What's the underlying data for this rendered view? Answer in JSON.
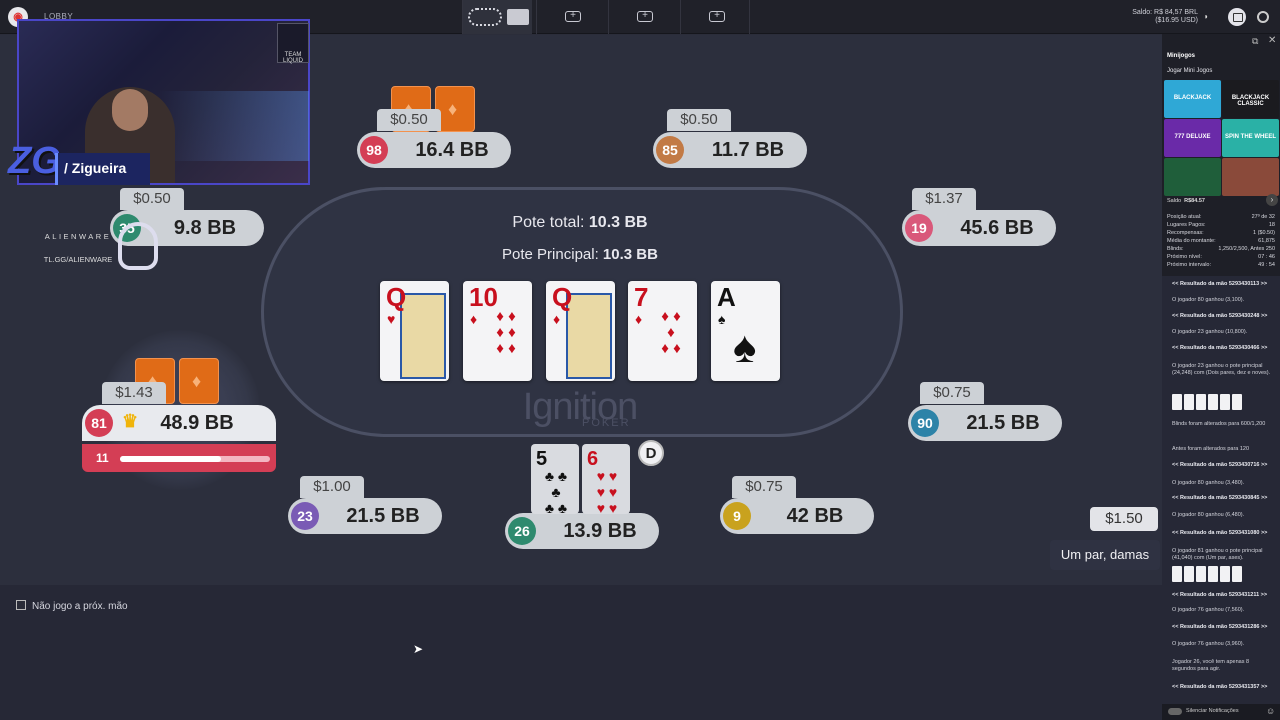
{
  "topbar": {
    "lobby_label": "LOBBY",
    "balance_line1": "Saldo: R$ 84,57 BRL",
    "balance_line2": "($16.95 USD)"
  },
  "table": {
    "pot_total_label": "Pote total:",
    "pot_total_value": "10.3 BB",
    "pot_main_label": "Pote Principal:",
    "pot_main_value": "10.3 BB",
    "watermark": "Ignition",
    "watermark_sub": "POKER",
    "board": [
      {
        "rank": "Q",
        "suit": "♥",
        "color": "red",
        "face": true
      },
      {
        "rank": "10",
        "suit": "♦",
        "color": "red",
        "face": false,
        "pips": "♦ ♦\n♦ ♦\n♦ ♦"
      },
      {
        "rank": "Q",
        "suit": "♦",
        "color": "red",
        "face": true
      },
      {
        "rank": "7",
        "suit": "♦",
        "color": "red",
        "face": false,
        "pips": "♦ ♦\n♦\n♦ ♦"
      },
      {
        "rank": "A",
        "suit": "♠",
        "color": "blk",
        "face": false,
        "ace": true
      }
    ],
    "dealer_label": "D"
  },
  "seats": [
    {
      "id": "98",
      "stack": "16.4 BB",
      "bet": "$0.50",
      "avatar_color": "#d43e55"
    },
    {
      "id": "85",
      "stack": "11.7 BB",
      "bet": "$0.50",
      "avatar_color": "#c27a45"
    },
    {
      "id": "35",
      "stack": "9.8 BB",
      "bet": "$0.50",
      "avatar_color": "#2e8a6e"
    },
    {
      "id": "19",
      "stack": "45.6 BB",
      "bet": "$1.37",
      "avatar_color": "#d9587a"
    },
    {
      "id": "81",
      "stack": "48.9 BB",
      "bet": "$1.43",
      "avatar_color": "#d43e55",
      "timer": "11",
      "timer_fraction": 0.67
    },
    {
      "id": "90",
      "stack": "21.5 BB",
      "bet": "$0.75",
      "avatar_color": "#2d83a8"
    },
    {
      "id": "23",
      "stack": "21.5 BB",
      "bet": "$1.00",
      "avatar_color": "#7a5bb5"
    },
    {
      "id": "26",
      "stack": "13.9 BB",
      "bet": "",
      "avatar_color": "#2e8a6e"
    },
    {
      "id": "9",
      "stack": "42 BB",
      "bet": "$0.75",
      "avatar_color": "#c9a21e"
    }
  ],
  "hero_cards": [
    {
      "rank": "5",
      "suit": "♣",
      "color": "blk",
      "pips": "♣ ♣\n♣\n♣ ♣"
    },
    {
      "rank": "6",
      "suit": "♥",
      "color": "red",
      "pips": "♥ ♥\n♥ ♥\n♥ ♥"
    }
  ],
  "actions": {
    "bet_amount": "$1.50",
    "hand_label": "Um par, damas",
    "sitout_label": "Não jogo a próx. mão"
  },
  "stream": {
    "name": "/ Zigueira",
    "sponsor": "ALIENWARE",
    "sponsor_url": "TL.GG/ALIENWARE",
    "team": "TEAM LIQUID"
  },
  "sidebar": {
    "title": "Minijogos",
    "subtitle": "Jogar Mini Jogos",
    "games": [
      "BLACKJACK",
      "BLACKJACK CLASSIC",
      "777 DELUXE",
      "SPIN THE WHEEL",
      "",
      ""
    ],
    "saldo_label": "Saldo",
    "saldo_value": "R$84.57",
    "stats": [
      {
        "k": "Posição atual:",
        "v": "27º de 32"
      },
      {
        "k": "Lugares Pagos:",
        "v": "18"
      },
      {
        "k": "Recompensas:",
        "v": "1 ($0.50)"
      },
      {
        "k": "Média do montante:",
        "v": "61,875"
      },
      {
        "k": "Blinds:",
        "v": "1,250/2,500, Antes 250"
      },
      {
        "k": "Próximo nível:",
        "v": "07 : 46"
      },
      {
        "k": "Próximo intervalo:",
        "v": "49 : 54"
      }
    ],
    "feed": [
      {
        "t": "<< Resultado da mão 5293430113 >>",
        "h": true
      },
      {
        "t": "O jogador 80 ganhou (3,100).",
        "h": false
      },
      {
        "t": "<< Resultado da mão 5293430248 >>",
        "h": true
      },
      {
        "t": "O jogador 23 ganhou (10,800).",
        "h": false
      },
      {
        "t": "<< Resultado da mão 5293430466 >>",
        "h": true
      },
      {
        "t": "O jogador 23 ganhou o pote principal (24,248) com (Dois pares, dez e noves).",
        "h": false
      },
      {
        "t": "Blinds foram alterados para 600/1,200",
        "h": false
      },
      {
        "t": "Antes foram alterados para 120",
        "h": false
      },
      {
        "t": "<< Resultado da mão 5293430716 >>",
        "h": true
      },
      {
        "t": "O jogador 80 ganhou (3,480).",
        "h": false
      },
      {
        "t": "<< Resultado da mão 5293430845 >>",
        "h": true
      },
      {
        "t": "O jogador 80 ganhou (6,480).",
        "h": false
      },
      {
        "t": "<< Resultado da mão 5293431080 >>",
        "h": true
      },
      {
        "t": "O jogador 81 ganhou o pote principal (41,040) com (Um par, ases).",
        "h": false
      },
      {
        "t": "<< Resultado da mão 5293431211 >>",
        "h": true
      },
      {
        "t": "O jogador 76 ganhou (7,560).",
        "h": false
      },
      {
        "t": "<< Resultado da mão 5293431286 >>",
        "h": true
      },
      {
        "t": "O jogador 76 ganhou (3,960).",
        "h": false
      },
      {
        "t": "Jogador 26, você tem apenas 8 segundos para agir.",
        "h": false
      },
      {
        "t": "<< Resultado da mão 5293431357 >>",
        "h": true
      }
    ],
    "silence_label": "Silenciar Notificações"
  }
}
